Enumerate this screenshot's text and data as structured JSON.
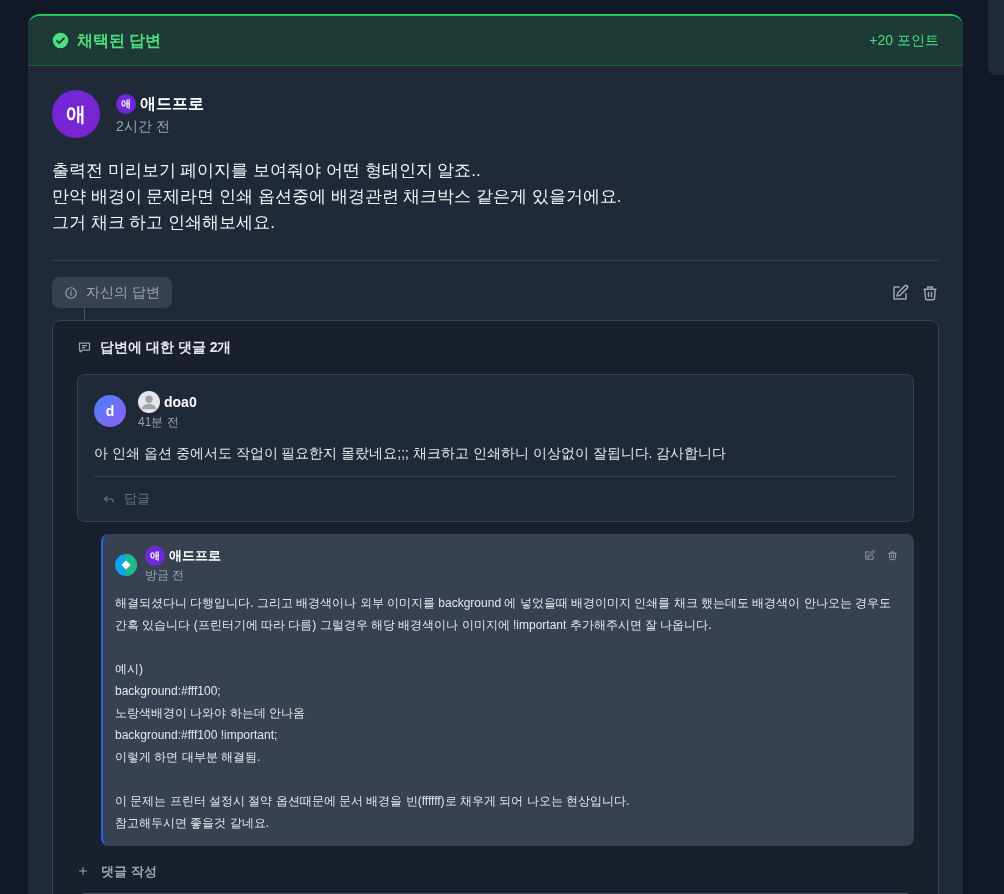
{
  "answer": {
    "badge": "채택된 답변",
    "points": "+20 포인트",
    "author": {
      "avatar": "애",
      "badge": "애",
      "name": "애드프로",
      "time": "2시간 전"
    },
    "body": "출력전 미리보기 페이지를 보여줘야 어떤 형태인지 알죠..\n만약 배경이 문제라면 인쇄 옵션중에 배경관련 채크박스 같은게 있을거에요.\n그거 채크 하고 인쇄해보세요.",
    "own_tag": "자신의 답변"
  },
  "comments": {
    "title": "답변에 대한 댓글 2개",
    "items": [
      {
        "kind": "comment",
        "avatar": "d",
        "name": "doa0",
        "time": "41분 전",
        "paragraphs": [
          "아 인쇄 옵션 중에서도 작업이 필요한지 몰랐네요;;; 채크하고 인쇄하니 이상없이 잘됩니다. 감사합니다"
        ],
        "reply_label": "답글"
      },
      {
        "kind": "reply",
        "badge": "애",
        "name": "애드프로",
        "time": "방금 전",
        "paragraphs": [
          "해결되셨다니 다행입니다. 그리고 배경색이나 외부 이미지를 background 에 넣었을때 배경이미지 인쇄를 채크 했는데도 배경색이 안나오는 경우도 간혹 있습니다 (프린터기에 따라 다름) 그럴경우 해당 배경색이나 이미지에 !important 추가해주시면 잘 나옵니다.",
          "예시)\nbackground:#fff100;\n노랑색배경이 나와야 하는데 안나옴\nbackground:#fff100 !important;\n이렇게 하면 대부분 해결됨.",
          "이 문제는 프린터 설정시 절약 옵션때문에 문서 배경을 빈(ffffff)로 채우게 되어 나오는 현상입니다.\n참고해두시면 좋을것 같네요."
        ]
      }
    ],
    "write_label": "댓글 작성"
  }
}
